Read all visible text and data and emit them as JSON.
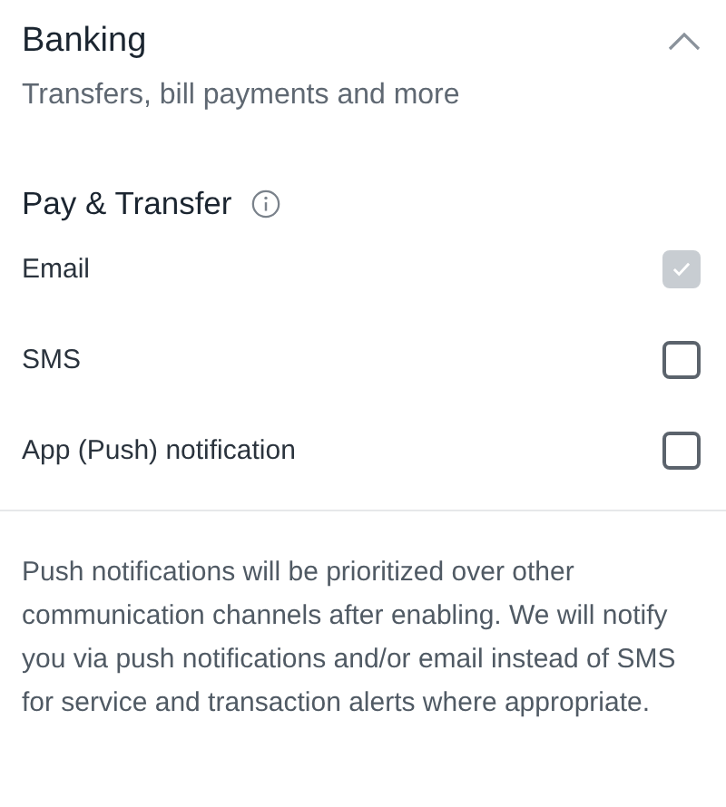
{
  "section": {
    "title": "Banking",
    "subtitle": "Transfers, bill payments and more",
    "expanded": true
  },
  "group": {
    "title": "Pay & Transfer"
  },
  "options": [
    {
      "label": "Email",
      "checked": true,
      "disabled": true
    },
    {
      "label": "SMS",
      "checked": false,
      "disabled": false
    },
    {
      "label": "App (Push) notification",
      "checked": false,
      "disabled": false
    }
  ],
  "note": "Push notifications will be prioritized over other communication channels after enabling. We will notify you via push notifications and/or email instead of SMS for service and transaction alerts where appropriate."
}
